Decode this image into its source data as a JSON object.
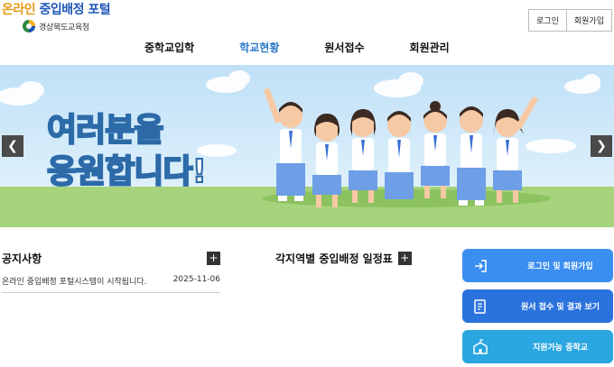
{
  "header": {
    "logo": {
      "title_part1": "온라인",
      "title_part2": "중입배정 포털",
      "subtitle": "경상북도교육청",
      "emblem_icon": "gyeongbuk-edu-emblem-icon"
    },
    "auth": {
      "login_label": "로그인",
      "signup_label": "회원가입"
    },
    "nav": [
      {
        "label": "중학교입학",
        "active": false
      },
      {
        "label": "학교현황",
        "active": true
      },
      {
        "label": "원서접수",
        "active": false
      },
      {
        "label": "회원관리",
        "active": false
      }
    ],
    "active_color": "#2a78c8"
  },
  "banner": {
    "text_line1": "여러분을",
    "text_line2": "응원합니다!",
    "prev_icon": "chevron-left-icon",
    "next_icon": "chevron-right-icon"
  },
  "notice": {
    "title": "공지사항",
    "more_icon": "plus-icon",
    "items": [
      {
        "title": "온라인 중입배정 포털시스템이 시작됩니다.",
        "date": "2025-11-06"
      }
    ]
  },
  "schedule": {
    "title": "각지역별 중입배정 일정표",
    "more_icon": "plus-icon"
  },
  "quick_links": [
    {
      "label": "로그인 및 회원가입",
      "icon": "login-arrow-icon",
      "color": "#3a8ef0"
    },
    {
      "label": "원서 접수 및 결과 보기",
      "icon": "application-form-icon",
      "color": "#2a73dd"
    },
    {
      "label": "지원가능 중학교",
      "icon": "school-building-icon",
      "color": "#2aa6e0"
    }
  ]
}
